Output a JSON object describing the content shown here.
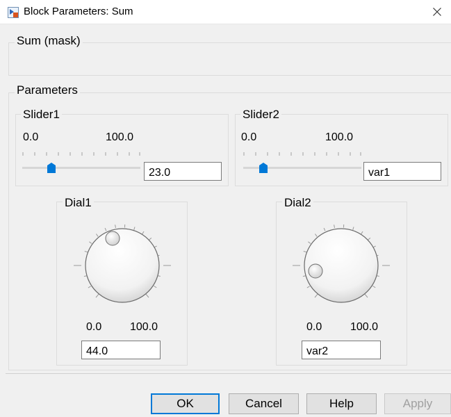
{
  "window": {
    "title": "Block Parameters: Sum"
  },
  "mask": {
    "title": "Sum (mask)"
  },
  "parameters": {
    "label": "Parameters",
    "slider1": {
      "label": "Slider1",
      "min": "0.0",
      "max": "100.0",
      "value": "23.0",
      "level": 0.23
    },
    "slider2": {
      "label": "Slider2",
      "min": "0.0",
      "max": "100.0",
      "value": "var1",
      "level": 0.15
    },
    "dial1": {
      "label": "Dial1",
      "min": "0.0",
      "max": "100.0",
      "value": "44.0",
      "level": 0.44
    },
    "dial2": {
      "label": "Dial2",
      "min": "0.0",
      "max": "100.0",
      "value": "var2",
      "level": 0.18
    }
  },
  "buttons": {
    "ok": "OK",
    "cancel": "Cancel",
    "help": "Help",
    "apply": "Apply"
  },
  "colors": {
    "accent": "#0078d7",
    "disabled_text": "#a0a0a0"
  },
  "icons": {
    "app": "simulink-block-icon",
    "close": "close-icon"
  }
}
